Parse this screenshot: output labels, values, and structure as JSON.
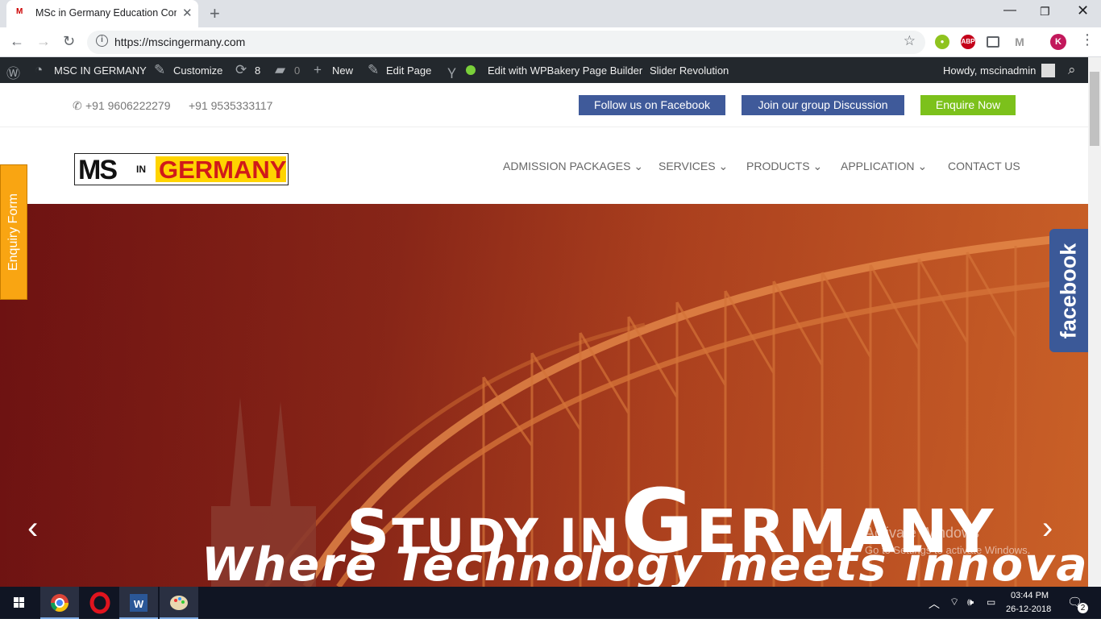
{
  "browser": {
    "tab_title": "MSc in Germany Education Cons",
    "favicon_text": "M",
    "url": "https://mscingermany.com",
    "profile_initial": "K",
    "ext_abp": "ABP"
  },
  "adminbar": {
    "site": "MSC IN GERMANY",
    "customize": "Customize",
    "updates": "8",
    "comments": "0",
    "new": "New",
    "edit_page": "Edit Page",
    "wpbakery": "Edit with WPBakery Page Builder",
    "slider": "Slider Revolution",
    "howdy": "Howdy, mscinadmin"
  },
  "topbar": {
    "phone1": "+91 9606222279",
    "phone2": "+91 9535333117",
    "btn_facebook": "Follow us on Facebook",
    "btn_group": "Join our group Discussion",
    "btn_enquire": "Enquire Now"
  },
  "logo": {
    "part1": "MS",
    "part2": "IN",
    "part3": "GERMANY"
  },
  "nav": {
    "admission": "ADMISSION PACKAGES",
    "services": "SERVICES",
    "products": "PRODUCTS",
    "application": "APPLICATION",
    "contact": "CONTACT US"
  },
  "hero": {
    "study_s": "S",
    "study_rest": "TUDY IN",
    "germany_g": "G",
    "germany_rest": "ERMANY",
    "tagline": "Where Technology meets innovation"
  },
  "side": {
    "enquiry": "Enquiry Form",
    "facebook": "facebook"
  },
  "watermark": {
    "line1": "Activate Windows",
    "line2": "Go to Settings to activate Windows."
  },
  "taskbar": {
    "time": "03:44 PM",
    "date": "26-12-2018",
    "notif_count": "2"
  },
  "colors": {
    "fb_blue": "#3f5a9a",
    "enquire_green": "#7cc11b",
    "hero_red": "#7a1a14",
    "enquiry_orange": "#f9a512"
  }
}
